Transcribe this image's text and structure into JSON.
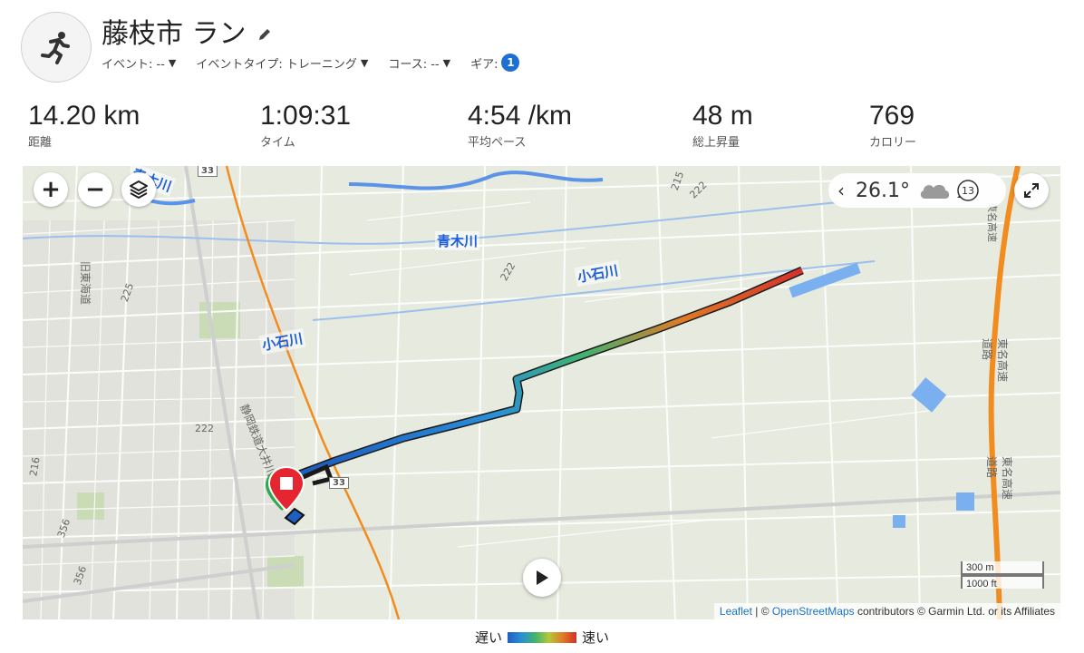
{
  "activity": {
    "title": "藤枝市 ラン",
    "icon": "running-person-icon",
    "event_label": "イベント: --",
    "event_type_label": "イベントタイプ: トレーニング",
    "course_label": "コース: --",
    "gear_label": "ギア:",
    "gear_count": "1"
  },
  "stats": [
    {
      "value": "14.20 km",
      "label": "距離"
    },
    {
      "value": "1:09:31",
      "label": "タイム"
    },
    {
      "value": "4:54 /km",
      "label": "平均ペース"
    },
    {
      "value": "48 m",
      "label": "総上昇量"
    },
    {
      "value": "769",
      "label": "カロリー"
    }
  ],
  "map": {
    "zoom_in": "+",
    "zoom_out": "−",
    "temperature": "26.1°",
    "wind_speed": "13",
    "scale_metric": "300 m",
    "scale_imperial": "1000 ft",
    "attribution_leaflet": "Leaflet",
    "attribution_sep": " | © ",
    "attribution_osm": "OpenStreetMaps",
    "attribution_rest": " contributors © Garmin Ltd. or its Affiliates",
    "labels": {
      "aoki_river": "青木川",
      "koishi_river_1": "小石川",
      "koishi_river_2": "小石川",
      "aoki_river_top": "青木川",
      "railway": "静岡鉄道大井川線",
      "old_tokaido": "旧東海道",
      "tomei_1": "東名高速道路",
      "tomei_2": "東名高速道路",
      "tomei_top": "東名高速"
    },
    "route_numbers": [
      "33",
      "33",
      "222",
      "222",
      "215",
      "225",
      "216",
      "356",
      "356",
      "222"
    ]
  },
  "legend": {
    "slow": "遅い",
    "fast": "速い"
  },
  "colors": {
    "route_slow": "#1f5fbf",
    "route_fast": "#d4302a",
    "river": "#1d5fd6",
    "highway": "#f28c1e",
    "start_marker": "#2fa84f",
    "end_marker": "#e52630"
  }
}
